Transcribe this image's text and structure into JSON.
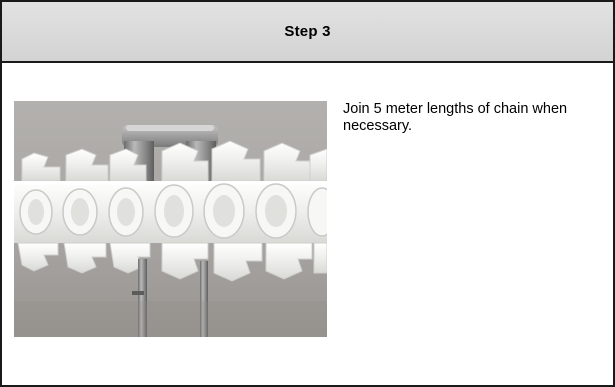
{
  "step": {
    "title": "Step 3",
    "instruction": "Join 5 meter lengths of chain when necessary."
  },
  "photo": {
    "subject": "chain-joining-photo",
    "colors": {
      "background": "#a9a6a3",
      "chain": "#f3f3f1",
      "metal": "#8d8d8d"
    }
  }
}
